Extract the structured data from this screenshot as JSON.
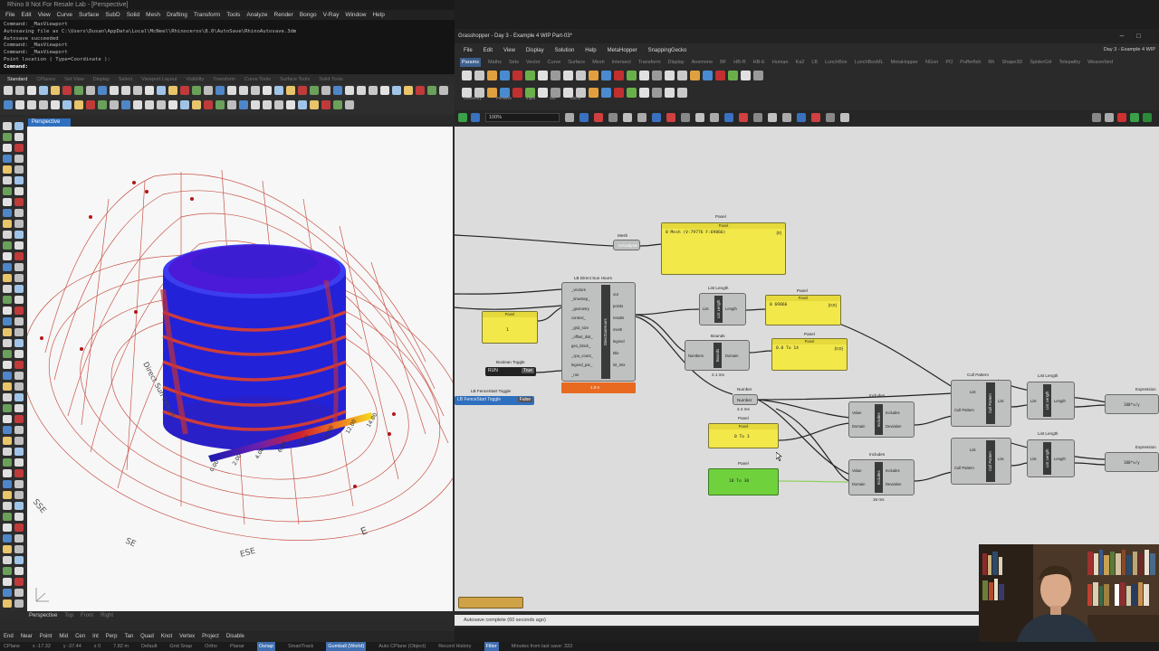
{
  "rhino": {
    "title": "Rhino 8 Not For Resale Lab - [Perspective]",
    "menus": [
      "File",
      "Edit",
      "View",
      "Curve",
      "Surface",
      "SubD",
      "Solid",
      "Mesh",
      "Drafting",
      "Transform",
      "Tools",
      "Analyze",
      "Render",
      "Bongo",
      "V-Ray",
      "Window",
      "Help"
    ],
    "command_history": [
      "Command: _MaxViewport",
      "Autosaving file as C:\\Users\\Dusan\\AppData\\Local\\McNeel\\Rhinoceros\\8.0\\AutoSave\\RhinoAutosave.3dm",
      "Autosave succeeded",
      "Command: _MaxViewport",
      "Command: _MaxViewport",
      "Point location ( Type=Coordinate ):"
    ],
    "command_prompt": "Command:",
    "tabs": [
      "Standard",
      "CPlanes",
      "Set View",
      "Display",
      "Select",
      "Viewport Layout",
      "Visibility",
      "Transform",
      "Curve Tools",
      "Surface Tools",
      "Solid Tools"
    ],
    "active_tab": "Standard",
    "viewport_tab": "Perspective",
    "bottom_tabs": [
      "Perspective",
      "Top",
      "Front",
      "Right"
    ],
    "osnaps": [
      "End",
      "Near",
      "Point",
      "Mid",
      "Cen",
      "Int",
      "Perp",
      "Tan",
      "Quad",
      "Knot",
      "Vertex",
      "Project",
      "Disable"
    ],
    "status_items": [
      "CPlane",
      "x -17.32",
      "y -37.44",
      "z 0",
      "7.82 m",
      "Default",
      "Grid Snap",
      "Ortho",
      "Planar",
      "Osnap",
      "SmartTrack",
      "Gumball (World)",
      "Auto CPlane (Object)",
      "Record History",
      "Filter",
      "Minutes from last save: 333"
    ],
    "active_status": [
      "Osnap",
      "Gumball (World)",
      "Filter"
    ]
  },
  "viewport": {
    "compass_labels": [
      "SE",
      "SSE",
      "ESE",
      "E"
    ],
    "axis_label": "Direct Sun Hours",
    "legend_ticks": [
      "0.00",
      "2.00",
      "4.00",
      "6.00",
      "8.00",
      "10.00",
      "12.00",
      "14.00"
    ]
  },
  "grasshopper": {
    "title": "Grasshopper - Day 3 - Example 4 WIP Part-03*",
    "doc_label": "Day 3 - Example 4 WIP",
    "menus": [
      "File",
      "Edit",
      "View",
      "Display",
      "Solution",
      "Help",
      "MetaHopper",
      "SnappingGecko"
    ],
    "component_tabs": [
      "Params",
      "Maths",
      "Sets",
      "Vector",
      "Curve",
      "Surface",
      "Mesh",
      "Intersect",
      "Transform",
      "Display",
      "Anemone",
      "BF",
      "HB-R",
      "HB-E",
      "Human",
      "Ka2",
      "LB",
      "LunchBox",
      "LunchBoxML",
      "MetaHopper",
      "NGon",
      "PO",
      "Pufferfish",
      "Rh",
      "Shape3D",
      "SpiderGH",
      "Telepathy",
      "Weaverbird"
    ],
    "active_component_tab": "Params",
    "ribbon_categories": [
      "Geometry",
      "Primitive",
      "Input",
      "Util",
      "Rhino"
    ],
    "zoom": "100%",
    "status": "Autosave complete (60 seconds ago)"
  },
  "canvas": {
    "mesh_param": "Mesh",
    "mesh_nick": "mAnalysis",
    "panel_main": {
      "title": "Panel",
      "text": "0 Mesh (V:79776 F:69866)",
      "index": "{0}"
    },
    "lb_component": {
      "title": "LB Direct Sun Hours",
      "inputs": [
        "_vectors",
        "_timestep_",
        "_geometry",
        "context_",
        "_grid_size",
        "_offset_dist_",
        "geo_block_",
        "_cpu_count_",
        "legend_par_",
        "_run"
      ],
      "outputs": [
        "out",
        "points",
        "results",
        "mesh",
        "legend",
        "title",
        "int_mtx"
      ],
      "strip": "DirectSunHours",
      "timer": "1.0 s"
    },
    "panel_input": {
      "title": "Panel",
      "text": "1"
    },
    "bool_toggle": {
      "title": "Boolean Toggle",
      "name": "RUN",
      "value": "True"
    },
    "fence_toggle": {
      "title": "LB FenceStart Toggle",
      "name": "LB FenceStart Toggle",
      "value": "False"
    },
    "list_length_1": {
      "title": "List Length",
      "in": "List",
      "out": "Length"
    },
    "panel_length": {
      "title": "Panel",
      "text": "0 69866",
      "index": "{0;0}"
    },
    "bounds": {
      "title": "Bounds",
      "in": "Numbers",
      "out": "Domain",
      "strip": "Bounds",
      "timer": "2.1 ms"
    },
    "panel_domain": {
      "title": "Panel",
      "text": "0.0 To 14",
      "index": "{0;0}"
    },
    "number_param": {
      "title": "Number",
      "timer": "2.4 ms"
    },
    "panel_0to3": {
      "title": "Panel",
      "text": "0 To 3"
    },
    "panel_10to30": {
      "title": "Panel",
      "text": "10 To 30"
    },
    "includes_1": {
      "title": "Includes",
      "in1": "Value",
      "in2": "Domain",
      "out1": "Includes",
      "out2": "Deviation",
      "strip": "Includes"
    },
    "includes_2": {
      "title": "Includes",
      "in1": "Value",
      "in2": "Domain",
      "out1": "Includes",
      "out2": "Deviation",
      "strip": "Includes",
      "timer": "16 ms"
    },
    "cull_1": {
      "title": "Cull Pattern",
      "in1": "List",
      "in2": "Cull Pattern",
      "out": "List",
      "strip": "Cull Pattern"
    },
    "cull_2": {
      "title": "Cull Pattern",
      "in1": "List",
      "in2": "Cull Pattern",
      "out": "List",
      "strip": "Cull Pattern"
    },
    "list_length_2": {
      "title": "List Length",
      "in": "List",
      "out": "Length"
    },
    "list_length_3": {
      "title": "List Length",
      "in": "List",
      "out": "Length"
    },
    "expr_1": {
      "title": "Expression",
      "text": "100*x/y"
    },
    "expr_2": {
      "title": "Expression",
      "text": "100*x/y"
    }
  },
  "colors": {
    "panel_yellow": "#f2e84a",
    "panel_green": "#6fd23d",
    "canvas_bg": "#dcdcdc",
    "rhino_dark": "#2a2a2a",
    "accent_blue": "#2f6fbf",
    "wire": "#222222"
  }
}
